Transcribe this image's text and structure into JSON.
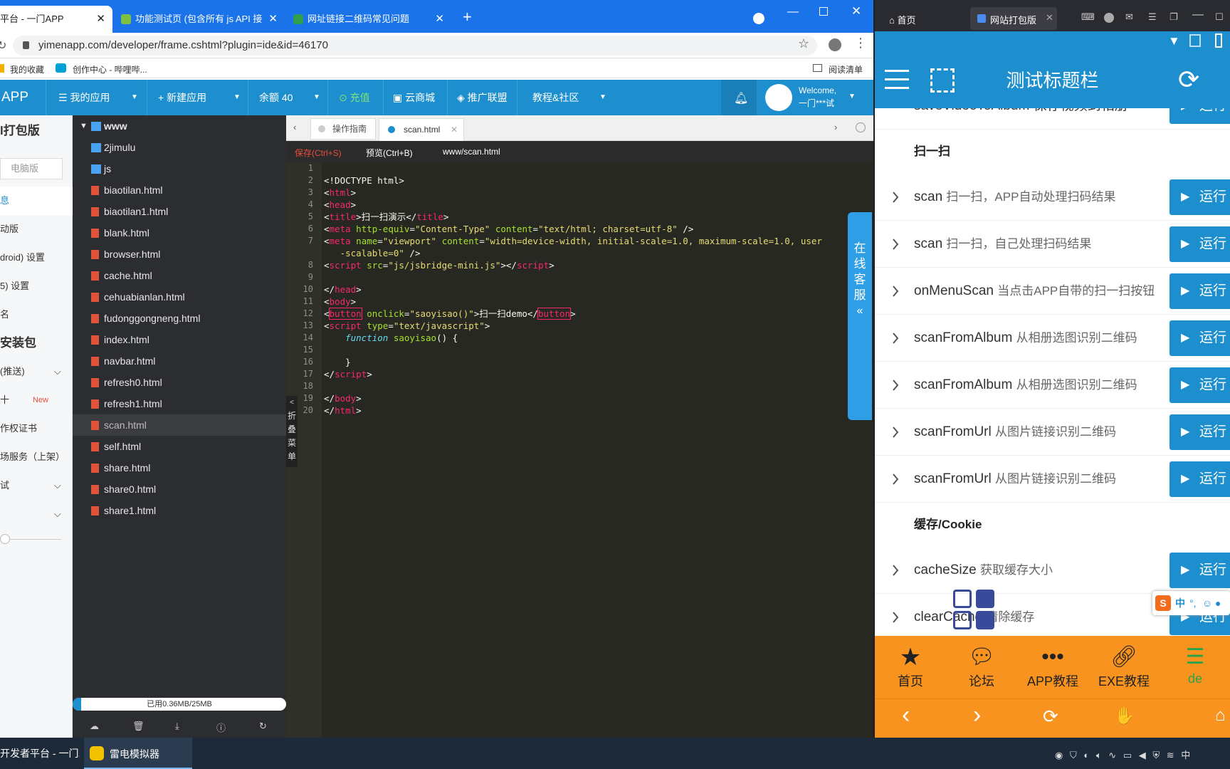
{
  "browser": {
    "tabs": [
      {
        "label": "平台 - 一门APP",
        "active": true
      },
      {
        "label": "功能测试页 (包含所有 js API 接口",
        "active": false
      },
      {
        "label": "网址链接二维码常见问题",
        "active": false
      }
    ],
    "url": "yimenapp.com/developer/frame.cshtml?plugin=ide&id=46170",
    "bookmarks": [
      "我的收藏",
      "创作中心 - 哔哩哔..."
    ],
    "reading_list": "阅读清单"
  },
  "app_nav": {
    "brand": "APP",
    "my_apps": "我的应用",
    "new_app": "新建应用",
    "balance": "余额 40",
    "recharge": "充值",
    "cloud_mall": "云商城",
    "affiliate": "推广联盟",
    "tutorial": "教程&社区",
    "welcome": "Welcome,",
    "user": "一门***试"
  },
  "sidebar": {
    "title": "l打包版",
    "pc_version": "电脑版",
    "items": [
      "息",
      "动版",
      "droid) 设置",
      "5) 设置",
      "名"
    ],
    "install_pkg": "安装包",
    "push": "(推送)",
    "new_item": "十",
    "new_badge": "New",
    "cert": "作权证书",
    "market": "场服务（上架）",
    "test": "试"
  },
  "tree": {
    "root": "www",
    "items": [
      "2jimulu",
      "js",
      "biaotilan.html",
      "biaotilan1.html",
      "blank.html",
      "browser.html",
      "cache.html",
      "cehuabianlan.html",
      "fudonggongneng.html",
      "index.html",
      "navbar.html",
      "refresh0.html",
      "refresh1.html",
      "scan.html",
      "self.html",
      "share.html",
      "share0.html",
      "share1.html"
    ],
    "storage": "已用0.36MB/25MB",
    "collapse": [
      "折",
      "叠",
      "菜",
      "单"
    ]
  },
  "editor": {
    "tabs": [
      "操作指南",
      "scan.html"
    ],
    "save": "保存(Ctrl+S)",
    "preview": "预览(Ctrl+B)",
    "path": "www/scan.html",
    "line_numbers": [
      "1",
      "2",
      "3",
      "4",
      "5",
      "6",
      "7",
      "",
      "8",
      "9",
      "10",
      "11",
      "12",
      "13",
      "14",
      "15",
      "16",
      "17",
      "18",
      "19",
      "20"
    ]
  },
  "chat_widget": [
    "在",
    "线",
    "客",
    "服"
  ],
  "phone": {
    "tabs": [
      "首页",
      "网站打包版"
    ],
    "title": "测试标题栏",
    "partial_row": "saveVideoToAlbum 保存视频到相册",
    "section_scan": "扫一扫",
    "section_cache": "缓存/Cookie",
    "run_label": "运行",
    "rows": [
      {
        "name": "scan",
        "desc": "扫一扫，APP自动处理扫码结果"
      },
      {
        "name": "scan",
        "desc": "扫一扫，自己处理扫码结果"
      },
      {
        "name": "onMenuScan",
        "desc": "当点击APP自带的扫一扫按钮"
      },
      {
        "name": "scanFromAlbum",
        "desc": "从相册选图识别二维码"
      },
      {
        "name": "scanFromAlbum",
        "desc": "从相册选图识别二维码"
      },
      {
        "name": "scanFromUrl",
        "desc": "从图片链接识别二维码"
      },
      {
        "name": "scanFromUrl",
        "desc": "从图片链接识别二维码"
      }
    ],
    "cache_rows": [
      {
        "name": "cacheSize",
        "desc": "获取缓存大小"
      },
      {
        "name": "clearCache",
        "desc": "清除缓存"
      }
    ],
    "bottom_tabs": [
      "首页",
      "论坛",
      "APP教程",
      "EXE教程",
      "de"
    ],
    "ime": "中"
  },
  "taskbar": {
    "items": [
      "开发者平台 - 一门...",
      "雷电模拟器"
    ],
    "tray_lang": "中"
  }
}
